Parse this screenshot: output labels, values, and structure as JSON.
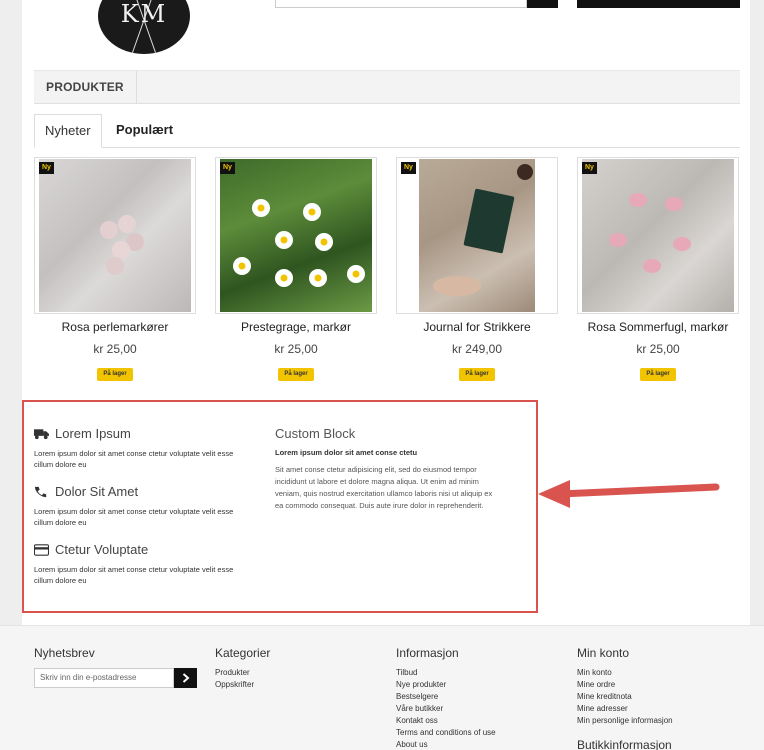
{
  "header": {
    "logo_text": "KM"
  },
  "nav": {
    "items": [
      {
        "label": "PRODUKTER"
      }
    ]
  },
  "tabs": [
    {
      "label": "Nyheter",
      "active": true
    },
    {
      "label": "Populært",
      "active": false
    }
  ],
  "products": [
    {
      "name": "Rosa perlemarkører",
      "price": "kr 25,00",
      "badge": "Ny",
      "stock": "På lager"
    },
    {
      "name": "Prestegrage, markør",
      "price": "kr 25,00",
      "badge": "Ny",
      "stock": "På lager"
    },
    {
      "name": "Journal for Strikkere",
      "price": "kr 249,00",
      "badge": "Ny",
      "stock": "På lager"
    },
    {
      "name": "Rosa Sommerfugl, markør",
      "price": "kr 25,00",
      "badge": "Ny",
      "stock": "På lager"
    }
  ],
  "info_blocks": [
    {
      "icon": "truck-icon",
      "title": "Lorem Ipsum",
      "text": "Lorem ipsum dolor sit amet conse ctetur voluptate velit esse cillum dolore eu"
    },
    {
      "icon": "phone-icon",
      "title": "Dolor Sit Amet",
      "text": "Lorem ipsum dolor sit amet conse ctetur voluptate velit esse cillum dolore eu"
    },
    {
      "icon": "credit-card-icon",
      "title": "Ctetur Voluptate",
      "text": "Lorem ipsum dolor sit amet conse ctetur voluptate velit esse cillum dolore eu"
    }
  ],
  "custom_block": {
    "title": "Custom Block",
    "subtitle": "Lorem ipsum dolor sit amet conse ctetu",
    "text": "Sit amet conse ctetur adipisicing elit, sed do eiusmod tempor incididunt ut labore et dolore magna aliqua. Ut enim ad minim veniam, quis nostrud exercitation ullamco laboris nisi ut aliquip ex ea commodo consequat. Duis aute irure dolor in reprehenderit."
  },
  "footer": {
    "newsletter": {
      "title": "Nyhetsbrev",
      "placeholder": "Skriv inn din e-postadresse",
      "button_icon": "chevron-right-icon"
    },
    "categories": {
      "title": "Kategorier",
      "links": [
        "Produkter",
        "Oppskrifter"
      ]
    },
    "information": {
      "title": "Informasjon",
      "links": [
        "Tilbud",
        "Nye produkter",
        "Bestselgere",
        "Våre butikker",
        "Kontakt oss",
        "Terms and conditions of use",
        "About us"
      ]
    },
    "account": {
      "title": "Min konto",
      "links": [
        "Min konto",
        "Mine ordre",
        "Mine kreditnota",
        "Mine adresser",
        "Min personlige informasjon"
      ]
    },
    "store_info": {
      "title": "Butikkinformasjon"
    }
  },
  "colors": {
    "accent_yellow": "#f2c400",
    "highlight_red": "#d9534f",
    "dark": "#111111"
  }
}
